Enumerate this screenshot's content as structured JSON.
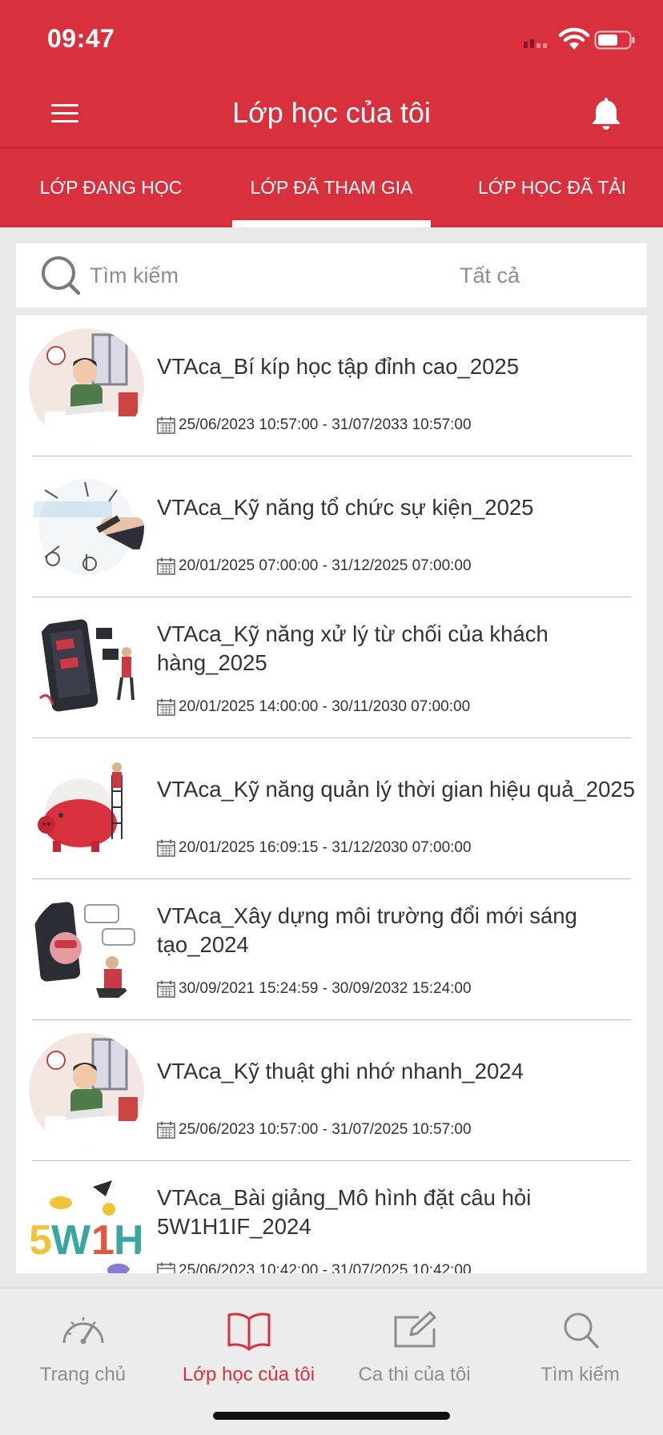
{
  "status_bar": {
    "time": "09:47"
  },
  "header": {
    "title": "Lớp học của tôi",
    "tabs": [
      {
        "label": "LỚP ĐANG HỌC",
        "active": false
      },
      {
        "label": "LỚP ĐÃ THAM GIA",
        "active": true
      },
      {
        "label": "LỚP HỌC ĐÃ TẢI",
        "active": false
      }
    ]
  },
  "search": {
    "placeholder": "Tìm kiếm",
    "value": "",
    "filter_label": "Tất cả"
  },
  "classes": [
    {
      "title": "VTAca_Bí kíp học tập đỉnh cao_2025",
      "date_range": "25/06/2023 10:57:00 - 31/07/2033 10:57:00",
      "thumbnail": "student-studying-illustration"
    },
    {
      "title": "VTAca_Kỹ năng tổ chức sự kiện_2025",
      "date_range": "20/01/2025 07:00:00 - 31/12/2025 07:00:00",
      "thumbnail": "event-management-illustration"
    },
    {
      "title": "VTAca_Kỹ năng xử lý từ chối của khách hàng_2025",
      "date_range": "20/01/2025 14:00:00 - 30/11/2030 07:00:00",
      "thumbnail": "mobile-app-illustration"
    },
    {
      "title": "VTAca_Kỹ năng quản lý thời gian hiệu quả_2025",
      "date_range": "20/01/2025 16:09:15 - 31/12/2030 07:00:00",
      "thumbnail": "piggy-bank-illustration"
    },
    {
      "title": "VTAca_Xây dựng môi trường đổi mới sáng tạo_2024",
      "date_range": "30/09/2021 15:24:59 - 30/09/2032 15:24:00",
      "thumbnail": "innovation-chat-illustration"
    },
    {
      "title": "VTAca_Kỹ thuật ghi nhớ nhanh_2024",
      "date_range": "25/06/2023 10:57:00 - 31/07/2025 10:57:00",
      "thumbnail": "student-studying-illustration"
    },
    {
      "title": "VTAca_Bài giảng_Mô hình đặt câu hỏi 5W1H1IF_2024",
      "date_range": "25/06/2023 10:42:00 - 31/07/2025 10:42:00",
      "thumbnail": "5w1h-illustration"
    }
  ],
  "bottom_nav": [
    {
      "label": "Trang chủ",
      "icon": "speedometer-icon",
      "active": false
    },
    {
      "label": "Lớp học của tôi",
      "icon": "open-book-icon",
      "active": true
    },
    {
      "label": "Ca thi của tôi",
      "icon": "edit-note-icon",
      "active": false
    },
    {
      "label": "Tìm kiếm",
      "icon": "search-icon",
      "active": false
    }
  ],
  "colors": {
    "brand_red": "#d9303e",
    "text": "#333333",
    "muted": "#8d8d8d",
    "divider": "#bdbdbd"
  }
}
